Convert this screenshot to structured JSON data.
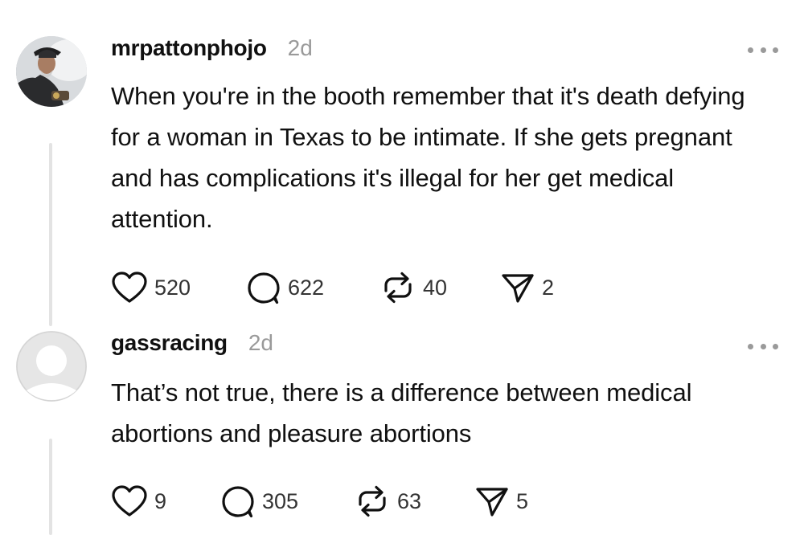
{
  "comments": [
    {
      "username": "mrpattonphojo",
      "time": "2d",
      "body": "When you're in the booth remember that it's death defying for a woman in Texas to be intimate. If she gets pregnant and has complications it's illegal for her get medical attention.",
      "likes": "520",
      "replies": "622",
      "reposts": "40",
      "shares": "2",
      "avatar_icon": "user-photo",
      "more_icon": "ellipsis-icon"
    },
    {
      "username": "gassracing",
      "time": "2d",
      "body": "That’s not true, there is a difference between medical abortions and pleasure abortions",
      "likes": "9",
      "replies": "305",
      "reposts": "63",
      "shares": "5",
      "avatar_icon": "default-avatar",
      "more_icon": "ellipsis-icon"
    }
  ],
  "icons": {
    "like": "heart-icon",
    "reply": "comment-bubble-icon",
    "repost": "repost-icon",
    "share": "send-icon"
  },
  "colors": {
    "text": "#101010",
    "muted": "#9a9a9a",
    "thread_line": "#e3e3e3"
  }
}
